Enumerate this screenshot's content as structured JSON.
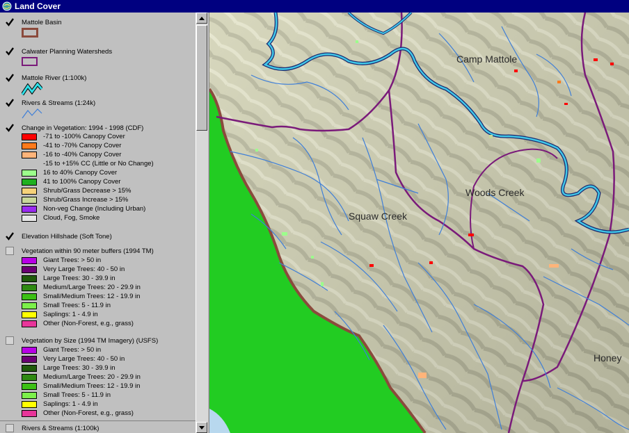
{
  "window": {
    "title": "Land Cover"
  },
  "legend": {
    "layers": [
      {
        "name": "Mattole Basin",
        "checked": true
      },
      {
        "name": "Calwater Planning Watersheds",
        "checked": true
      },
      {
        "name": "Mattole River (1:100k)",
        "checked": true
      },
      {
        "name": "Rivers & Streams (1:24k)",
        "checked": true
      },
      {
        "name": "Change in Vegetation: 1994 - 1998 (CDF)",
        "checked": true,
        "classes": [
          {
            "label": "-71 to -100% Canopy Cover",
            "color": "#ff0000"
          },
          {
            "label": "-41 to -70% Canopy Cover",
            "color": "#ff7a1a"
          },
          {
            "label": "-16 to -40% Canopy Cover",
            "color": "#ffb47a"
          },
          {
            "label": "-15 to +15% CC (Little or No Change)",
            "color": ""
          },
          {
            "label": "16 to 40% Canopy Cover",
            "color": "#9cff8c"
          },
          {
            "label": "41 to 100% Canopy Cover",
            "color": "#1fb01f"
          },
          {
            "label": "Shrub/Grass Decrease > 15%",
            "color": "#f5d27a"
          },
          {
            "label": "Shrub/Grass Increase > 15%",
            "color": "#c8d89a"
          },
          {
            "label": "Non-veg Change (Including Urban)",
            "color": "#9a2cf0"
          },
          {
            "label": "Cloud, Fog, Smoke",
            "color": "#e6e6e6"
          }
        ]
      },
      {
        "name": "Elevation Hillshade (Soft Tone)",
        "checked": true
      },
      {
        "name": "Vegetation within 90 meter buffers (1994 TM)",
        "checked": false,
        "classes": [
          {
            "label": "Giant Trees: > 50 in",
            "color": "#b800e6"
          },
          {
            "label": "Very Large Trees: 40 - 50 in",
            "color": "#6a0073"
          },
          {
            "label": "Large Trees: 30 - 39.9 in",
            "color": "#1e5a0a"
          },
          {
            "label": "Medium/Large Trees: 20 - 29.9 in",
            "color": "#2f8a12"
          },
          {
            "label": "Small/Medium Trees: 12 - 19.9 in",
            "color": "#3cc014"
          },
          {
            "label": "Small Trees: 5 - 11.9 in",
            "color": "#7cf04a"
          },
          {
            "label": "Saplings: 1 - 4.9 in",
            "color": "#ffff00"
          },
          {
            "label": "Other (Non-Forest, e.g., grass)",
            "color": "#e8359a"
          }
        ]
      },
      {
        "name": "Vegetation by Size (1994 TM Imagery) (USFS)",
        "checked": false,
        "classes": [
          {
            "label": "Giant Trees: > 50 in",
            "color": "#b800e6"
          },
          {
            "label": "Very Large Trees: 40 - 50 in",
            "color": "#6a0073"
          },
          {
            "label": "Large Trees: 30 - 39.9 in",
            "color": "#1e5a0a"
          },
          {
            "label": "Medium/Large Trees: 20 - 29.9 in",
            "color": "#2f8a12"
          },
          {
            "label": "Small/Medium Trees: 12 - 19.9 in",
            "color": "#3cc014"
          },
          {
            "label": "Small Trees: 5 - 11.9 in",
            "color": "#7cf04a"
          },
          {
            "label": "Saplings: 1 - 4.9 in",
            "color": "#ffff00"
          },
          {
            "label": "Other (Non-Forest, e.g., grass)",
            "color": "#e8359a"
          }
        ]
      },
      {
        "name": "Rivers & Streams (1:100k)",
        "checked": false
      }
    ]
  },
  "map": {
    "labels": [
      "Camp Mattole",
      "Woods Creek",
      "Squaw Creek",
      "Honey"
    ],
    "colors": {
      "basin_boundary": "#8b4a3c",
      "watershed_boundary": "#7a1a7a",
      "river": "#40c8e8",
      "stream": "#3f7fd8",
      "ocean_land": "#22cc22",
      "water": "#b8d8ee"
    }
  }
}
